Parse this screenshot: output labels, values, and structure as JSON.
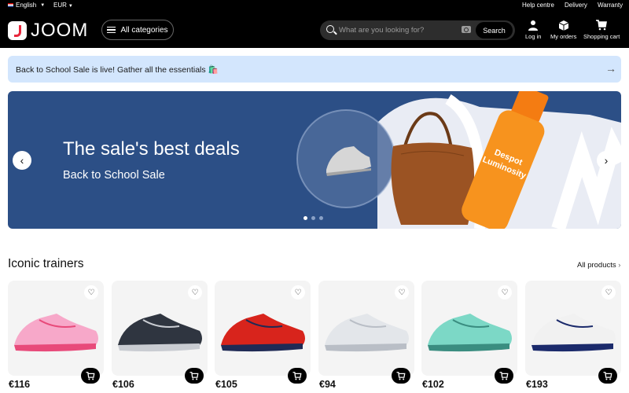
{
  "topbar": {
    "language": "English",
    "currency": "EUR",
    "help": "Help centre",
    "delivery": "Delivery",
    "warranty": "Warranty"
  },
  "header": {
    "logo": "JOOM",
    "all_categories": "All categories",
    "search_placeholder": "What are you looking for?",
    "search_button": "Search",
    "login": "Log in",
    "orders": "My orders",
    "cart": "Shopping cart"
  },
  "promo": {
    "text": "Back to School Sale is live!   Gather all the essentials 🛍️"
  },
  "banner": {
    "title": "The sale's best deals",
    "subtitle": "Back to School Sale",
    "slides": 3,
    "active_slide": 1,
    "colors": {
      "background": "#2c4f86",
      "accent": "#f7931e"
    }
  },
  "section": {
    "title": "Iconic trainers",
    "all_products": "All products"
  },
  "products": [
    {
      "price": "€116",
      "shoe_color": "#f7a8c9",
      "accent": "#e84a7a"
    },
    {
      "price": "€106",
      "shoe_color": "#2f3540",
      "accent": "#c9ccd2"
    },
    {
      "price": "€105",
      "shoe_color": "#d8241c",
      "accent": "#1f2a55"
    },
    {
      "price": "€94",
      "shoe_color": "#e3e6ea",
      "accent": "#b9bec6"
    },
    {
      "price": "€102",
      "shoe_color": "#7cd8c6",
      "accent": "#3a8d80"
    },
    {
      "price": "€193",
      "shoe_color": "#f1f1f1",
      "accent": "#1b2a6b"
    }
  ]
}
